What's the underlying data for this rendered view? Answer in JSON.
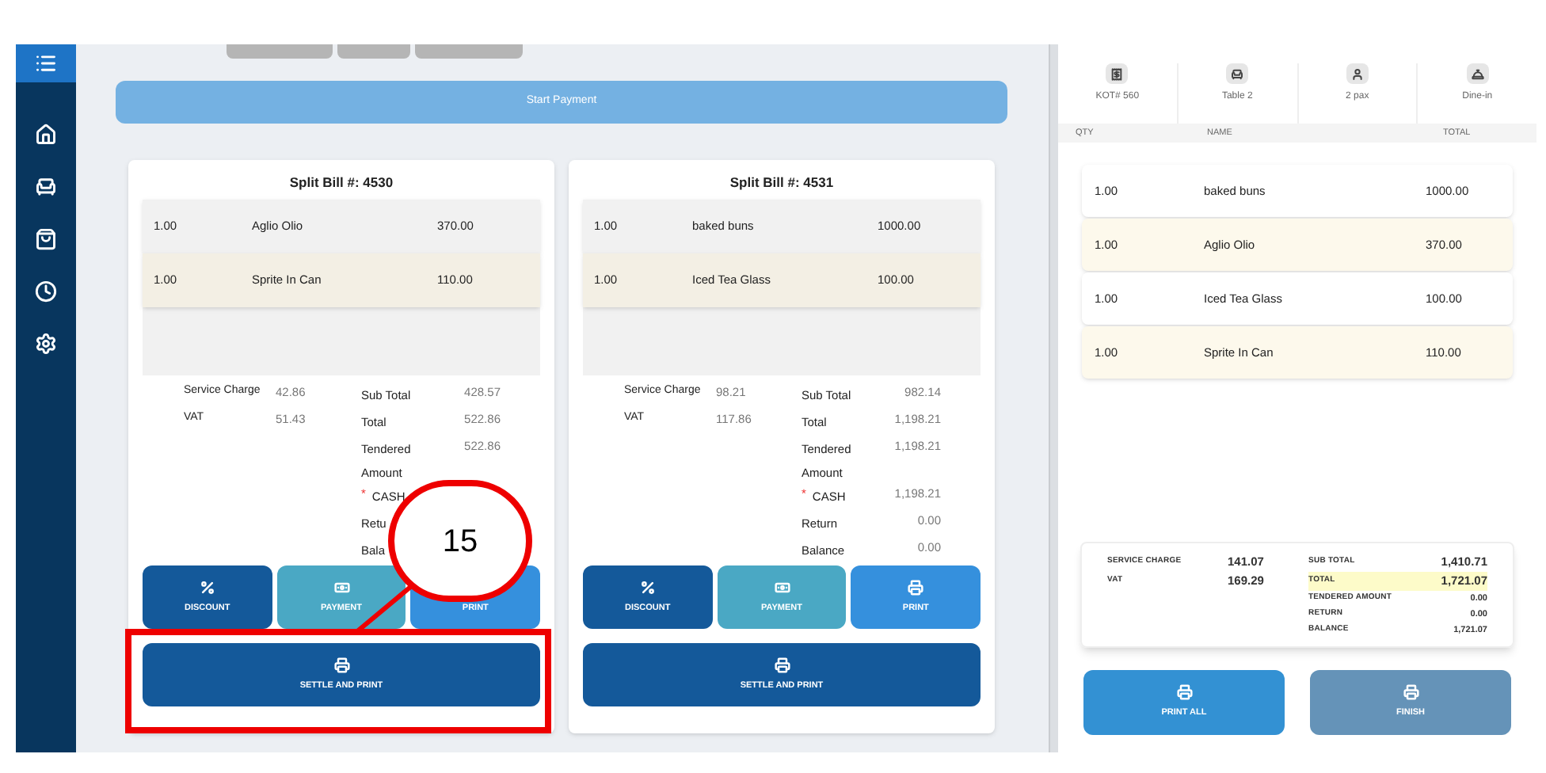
{
  "sidebar": {
    "items": [
      {
        "kind": "list",
        "selected": true
      },
      {
        "kind": "home",
        "selected": false
      },
      {
        "kind": "table",
        "selected": false
      },
      {
        "kind": "bag",
        "selected": false
      },
      {
        "kind": "clock",
        "selected": false
      },
      {
        "kind": "settings",
        "selected": false
      }
    ]
  },
  "start_payment_button": "Start Payment",
  "bills": [
    {
      "title": "Split Bill #: 4530",
      "items": [
        {
          "qty": "1.00",
          "name": "Aglio Olio",
          "total": "370.00"
        },
        {
          "qty": "1.00",
          "name": "Sprite In Can",
          "total": "110.00"
        }
      ],
      "charges": [
        {
          "label": "Service Charge",
          "value": "42.86"
        },
        {
          "label": "VAT",
          "value": "51.43"
        }
      ],
      "totals": [
        {
          "label": "Sub Total",
          "value": "428.57"
        },
        {
          "label": "Total",
          "value": "522.86"
        },
        {
          "label": "Tendered Amount",
          "value": "522.86"
        },
        {
          "label": "CASH",
          "marker": "*"
        },
        {
          "label": "Retu"
        },
        {
          "label": "Bala"
        }
      ],
      "buttons": [
        {
          "kind": "discount",
          "label": "DISCOUNT"
        },
        {
          "kind": "payment",
          "label": "PAYMENT"
        },
        {
          "kind": "print",
          "label": "PRINT",
          "icon_shown": false
        }
      ],
      "settle_button": "SETTLE AND PRINT"
    },
    {
      "title": "Split Bill #: 4531",
      "items": [
        {
          "qty": "1.00",
          "name": "baked buns",
          "total": "1000.00"
        },
        {
          "qty": "1.00",
          "name": "Iced Tea Glass",
          "total": "100.00"
        }
      ],
      "charges": [
        {
          "label": "Service Charge",
          "value": "98.21"
        },
        {
          "label": "VAT",
          "value": "117.86"
        }
      ],
      "totals": [
        {
          "label": "Sub Total",
          "value": "982.14"
        },
        {
          "label": "Total",
          "value": "1,198.21"
        },
        {
          "label": "Tendered Amount",
          "value": "1,198.21"
        },
        {
          "label": "CASH",
          "marker": "*",
          "value": "1,198.21"
        },
        {
          "label": "Return",
          "value": "0.00"
        },
        {
          "label": "Balance",
          "value": "0.00"
        }
      ],
      "buttons": [
        {
          "kind": "discount",
          "label": "DISCOUNT"
        },
        {
          "kind": "payment",
          "label": "PAYMENT"
        },
        {
          "kind": "print",
          "label": "PRINT"
        }
      ],
      "settle_button": "SETTLE AND PRINT"
    }
  ],
  "order": {
    "info": [
      {
        "kind": "receipt",
        "label": "KOT# 560"
      },
      {
        "kind": "table",
        "label": "Table 2"
      },
      {
        "kind": "person",
        "label": "2 pax"
      },
      {
        "kind": "dine",
        "label": "Dine-in"
      }
    ],
    "columns": [
      "QTY",
      "NAME",
      "TOTAL"
    ],
    "items": [
      {
        "qty": "1.00",
        "name": "baked buns",
        "total": "1000.00"
      },
      {
        "qty": "1.00",
        "name": "Aglio Olio",
        "total": "370.00"
      },
      {
        "qty": "1.00",
        "name": "Iced Tea Glass",
        "total": "100.00"
      },
      {
        "qty": "1.00",
        "name": "Sprite In Can",
        "total": "110.00"
      }
    ],
    "charges": [
      {
        "label": "SERVICE CHARGE",
        "value": "141.07"
      },
      {
        "label": "VAT",
        "value": "169.29"
      }
    ],
    "totals": [
      {
        "label": "SUB TOTAL",
        "value": "1,410.71",
        "highlighted": false,
        "large": true
      },
      {
        "label": "TOTAL",
        "value": "1,721.07",
        "highlighted": true,
        "large": true
      },
      {
        "label": "TENDERED AMOUNT",
        "value": "0.00",
        "highlighted": false,
        "large": false
      },
      {
        "label": "RETURN",
        "value": "0.00",
        "highlighted": false,
        "large": false
      },
      {
        "label": "BALANCE",
        "value": "1,721.07",
        "highlighted": false,
        "large": false
      }
    ],
    "buttons": [
      {
        "kind": "primary",
        "label": "PRINT ALL"
      },
      {
        "kind": "muted",
        "label": "FINISH"
      }
    ]
  },
  "annotation": {
    "label": "15"
  }
}
